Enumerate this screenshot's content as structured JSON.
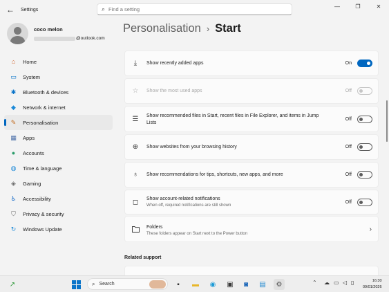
{
  "window": {
    "title": "Settings",
    "search_placeholder": "Find a setting",
    "controls": [
      "—",
      "❐",
      "✕"
    ]
  },
  "profile": {
    "name": "coco melon",
    "email_suffix": "@outlook.com"
  },
  "sidebar": {
    "items": [
      {
        "label": "Home",
        "icon": "home-icon",
        "glyph": "⌂",
        "color": "#d0622a"
      },
      {
        "label": "System",
        "icon": "system-icon",
        "glyph": "▭",
        "color": "#0a74c9"
      },
      {
        "label": "Bluetooth & devices",
        "icon": "bluetooth-icon",
        "glyph": "✱",
        "color": "#0a74c9"
      },
      {
        "label": "Network & internet",
        "icon": "wifi-icon",
        "glyph": "◆",
        "color": "#1d8ad8"
      },
      {
        "label": "Personalisation",
        "icon": "paintbrush-icon",
        "glyph": "✎",
        "color": "#c26b1f"
      },
      {
        "label": "Apps",
        "icon": "apps-icon",
        "glyph": "▦",
        "color": "#4a6ea8"
      },
      {
        "label": "Accounts",
        "icon": "accounts-icon",
        "glyph": "●",
        "color": "#2a9c6a"
      },
      {
        "label": "Time & language",
        "icon": "globe-clock-icon",
        "glyph": "◍",
        "color": "#1d8ad8"
      },
      {
        "label": "Gaming",
        "icon": "gamepad-icon",
        "glyph": "◈",
        "color": "#6c6c6c"
      },
      {
        "label": "Accessibility",
        "icon": "accessibility-icon",
        "glyph": "♿",
        "color": "#1d6fc9"
      },
      {
        "label": "Privacy & security",
        "icon": "shield-icon",
        "glyph": "⛉",
        "color": "#6c6c6c"
      },
      {
        "label": "Windows Update",
        "icon": "update-icon",
        "glyph": "↻",
        "color": "#1d8ad8"
      }
    ],
    "active_index": 4
  },
  "header": {
    "breadcrumb_parent": "Personalisation",
    "separator": "›",
    "current": "Start"
  },
  "settings": [
    {
      "label": "Show recently added apps",
      "state": "On",
      "on": true,
      "disabled": false,
      "icon": "download-icon",
      "glyph": "⤓"
    },
    {
      "label": "Show the most used apps",
      "state": "Off",
      "on": false,
      "disabled": true,
      "icon": "star-icon",
      "glyph": "☆"
    },
    {
      "label": "Show recommended files in Start, recent files in File Explorer, and items in Jump",
      "label2": "Lists",
      "state": "Off",
      "on": false,
      "disabled": false,
      "icon": "list-icon",
      "glyph": "☰"
    },
    {
      "label": "Show websites from your browsing history",
      "state": "Off",
      "on": false,
      "disabled": false,
      "icon": "globe-icon",
      "glyph": "⊕"
    },
    {
      "label": "Show recommendations for tips, shortcuts, new apps, and more",
      "state": "Off",
      "on": false,
      "disabled": false,
      "icon": "lightbulb-icon",
      "glyph": "♁"
    },
    {
      "label": "Show account-related notifications",
      "sub": "When off, required notifications are still shown",
      "state": "Off",
      "on": false,
      "disabled": false,
      "icon": "notification-icon",
      "glyph": "◻"
    }
  ],
  "folders": {
    "label": "Folders",
    "sub": "These folders appear on Start next to the Power button",
    "icon": "folder-icon"
  },
  "related_support": "Related support",
  "taskbar": {
    "search_label": "Search",
    "time": "16:30",
    "date": "09/01/2026",
    "accent": "#0067c0"
  }
}
